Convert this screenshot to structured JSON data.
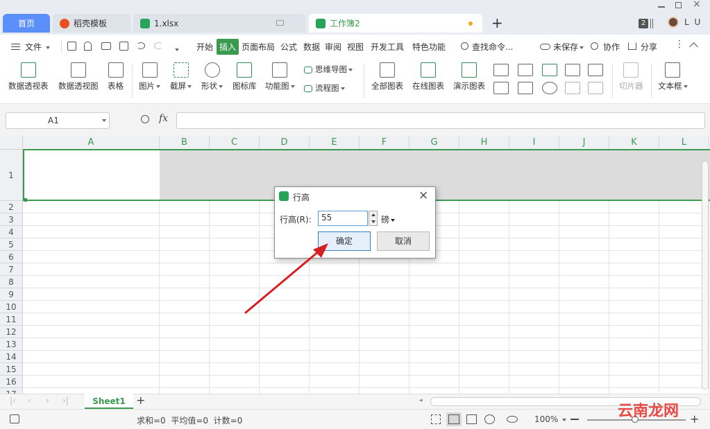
{
  "tabs": [
    {
      "label": "首页",
      "active": false,
      "icon": "home"
    },
    {
      "label": "稻壳模板",
      "active": false,
      "icon": "docer-icon"
    },
    {
      "label": "1.xlsx",
      "active": false,
      "icon": "sheet-icon"
    },
    {
      "label": "工作簿2",
      "active": true,
      "icon": "sheet-icon"
    }
  ],
  "titlebar": {
    "badge": "2",
    "user": "L U",
    "new_tab": "+"
  },
  "menu": {
    "file": "文件",
    "items": [
      "开始",
      "插入",
      "页面布局",
      "公式",
      "数据",
      "审阅",
      "视图",
      "开发工具",
      "特色功能"
    ],
    "active": "插入",
    "search": "查找命令...",
    "unsaved": "未保存",
    "collab": "协作",
    "share": "分享"
  },
  "ribbon": {
    "pivot_table": "数据透视表",
    "pivot_chart": "数据透视图",
    "table": "表格",
    "picture": "图片",
    "screenshot": "截屏",
    "shape": "形状",
    "icon_lib": "图标库",
    "function_chart": "功能图",
    "mindmap": "思维导图",
    "flowchart": "流程图",
    "all_charts": "全部图表",
    "online_chart": "在线图表",
    "demo_chart": "演示图表",
    "slicer": "切片器",
    "textbox": "文本框"
  },
  "formula": {
    "cell_ref": "A1",
    "fx": "fx",
    "value": ""
  },
  "columns": [
    "A",
    "B",
    "C",
    "D",
    "E",
    "F",
    "G",
    "H",
    "I",
    "J",
    "K",
    "L"
  ],
  "rows": [
    "1",
    "2",
    "3",
    "4",
    "5",
    "6",
    "7",
    "8",
    "9",
    "10",
    "11",
    "12",
    "13",
    "14",
    "15",
    "16",
    "17"
  ],
  "sheet": {
    "name": "Sheet1",
    "add": "+"
  },
  "status": {
    "text": "求和=0  平均值=0  计数=0",
    "zoom": "100%"
  },
  "dialog": {
    "title": "行高",
    "label": "行高(R):",
    "value": "55",
    "unit": "磅",
    "ok": "确定",
    "cancel": "取消"
  },
  "colors": {
    "accent": "#3a9a4e",
    "active_tab_bg": "#ffffff",
    "home_tab": "#5b8ff9",
    "arrow": "#d42020"
  }
}
